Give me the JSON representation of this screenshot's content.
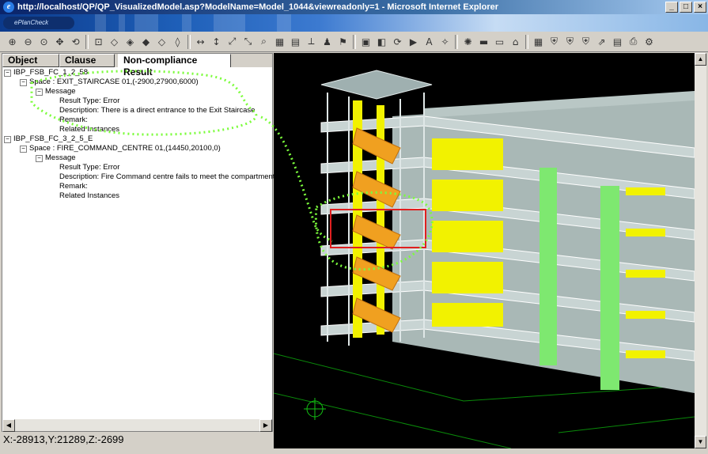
{
  "window": {
    "title": "http://localhost/QP/QP_VisualizedModel.asp?ModelName=Model_1044&viewreadonly=1 - Microsoft Internet Explorer",
    "minimize": "_",
    "maximize": "□",
    "close": "×"
  },
  "banner": {
    "logo_text": "ePlanCheck"
  },
  "toolbar": {
    "icons": [
      "zoom-in-icon",
      "zoom-out-icon",
      "zoom-window-icon",
      "pan-icon",
      "rotate-icon",
      "fit-icon",
      "view-iso-1-icon",
      "view-iso-2-icon",
      "view-iso-3-icon",
      "view-iso-4-icon",
      "view-iso-5-icon",
      "axis-x-icon",
      "axis-y-icon",
      "axis-z-icon",
      "axis-w-icon",
      "find-icon",
      "grid-icon",
      "layers-icon",
      "measure-icon",
      "walk-icon",
      "flag-icon",
      "box-icon",
      "section-icon",
      "orbit-icon",
      "select-icon",
      "text-icon",
      "target-icon",
      "light-icon",
      "ruler-icon",
      "camera-icon",
      "building-icon",
      "frame-icon",
      "shield-1-icon",
      "shield-2-icon",
      "shield-3-icon",
      "export-icon",
      "report-icon",
      "print-icon",
      "settings-icon"
    ]
  },
  "tabs": [
    "Object",
    "Clause",
    "Non-compliance Result"
  ],
  "tree": {
    "item1": {
      "id": "IBP_FSB_FC_1_2_58",
      "space": "Space : EXIT_STAIRCASE 01,(-2900,27900,6000)",
      "message": "Message",
      "result_type": "Result Type: Error",
      "description": "Description: There is a direct entrance to the Exit Staircase",
      "remark": "Remark:",
      "related": "Related Instances"
    },
    "item2": {
      "id": "IBP_FSB_FC_3_2_5_E",
      "space": "Space : FIRE_COMMAND_CENTRE 01,(14450,20100,0)",
      "message": "Message",
      "result_type": "Result Type: Error",
      "description": "Description: Fire Command centre fails to meet the compartment",
      "remark": "Remark:",
      "related": "Related Instances"
    }
  },
  "status": {
    "coords": "X:-28913,Y:21289,Z:-2699"
  },
  "colors": {
    "title_bar_start": "#0a246a",
    "viewport_bg": "#000000",
    "highlight_dots": "#7cfc3c",
    "stairs": "#f0a020",
    "yellow_panels": "#f2f200",
    "green_columns": "#7ee870",
    "slab": "#b8c8c8",
    "selection": "#e02020"
  }
}
